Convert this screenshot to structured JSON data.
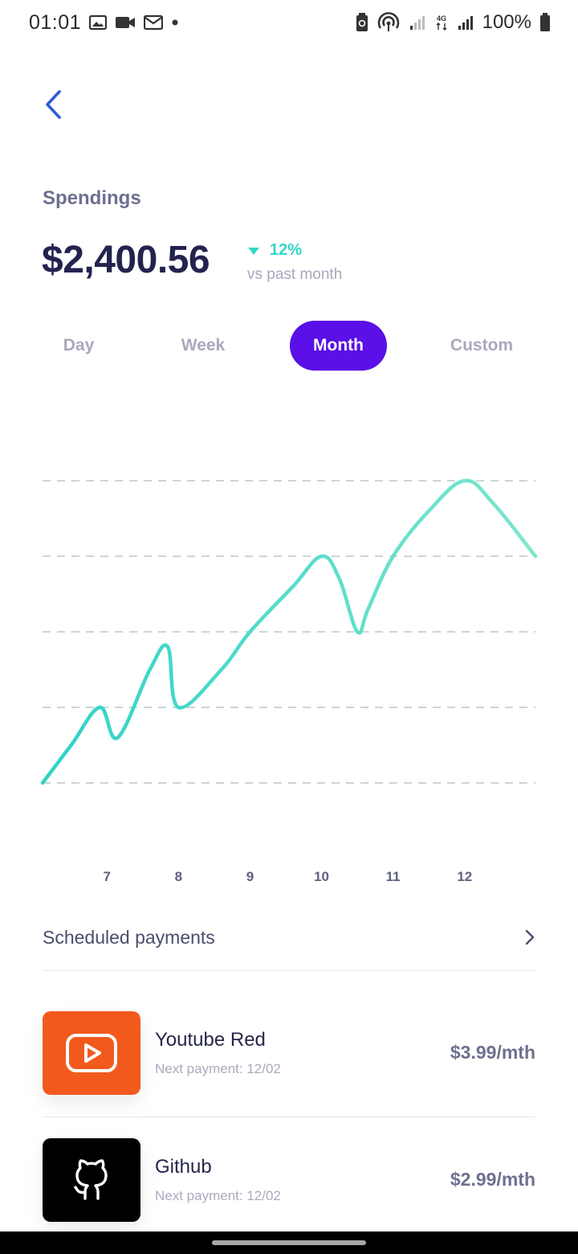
{
  "status": {
    "time": "01:01",
    "battery": "100%",
    "network": "4G"
  },
  "header": {
    "title": "Spendings",
    "amount": "$2,400.56",
    "change": "12%",
    "change_caption": "vs past month"
  },
  "tabs": [
    {
      "label": "Day",
      "active": false
    },
    {
      "label": "Week",
      "active": false
    },
    {
      "label": "Month",
      "active": true
    },
    {
      "label": "Custom",
      "active": false
    }
  ],
  "chart_data": {
    "type": "line",
    "x": [
      6.1,
      6.5,
      6.9,
      7.15,
      7.6,
      7.85,
      8.0,
      8.6,
      9.0,
      9.6,
      10.0,
      10.25,
      10.5,
      10.65,
      11.0,
      11.5,
      12.0,
      12.4,
      12.99
    ],
    "values": [
      0.0,
      0.5,
      1.0,
      0.6,
      1.5,
      1.8,
      1.0,
      1.5,
      2.0,
      2.6,
      3.0,
      2.7,
      2.0,
      2.3,
      3.0,
      3.6,
      4.0,
      3.7,
      3.0
    ],
    "x_ticks": [
      "7",
      "8",
      "9",
      "10",
      "11",
      "12"
    ],
    "xlim": [
      6.1,
      12.99
    ],
    "ylim": [
      0,
      4
    ],
    "grid": true,
    "line_colors": [
      "#2ed3c6",
      "#7ee6cd"
    ]
  },
  "scheduled": {
    "title": "Scheduled payments",
    "items": [
      {
        "name": "Youtube Red",
        "next": "Next payment: 12/02",
        "amount": "$3.99/mth",
        "color": "#f15a1c",
        "icon": "play-icon"
      },
      {
        "name": "Github",
        "next": "Next payment: 12/02",
        "amount": "$2.99/mth",
        "color": "#000000",
        "icon": "github-icon"
      }
    ]
  },
  "colors": {
    "accent": "#5a10e6",
    "positive": "#33d6c8",
    "heading": "#23234f"
  }
}
